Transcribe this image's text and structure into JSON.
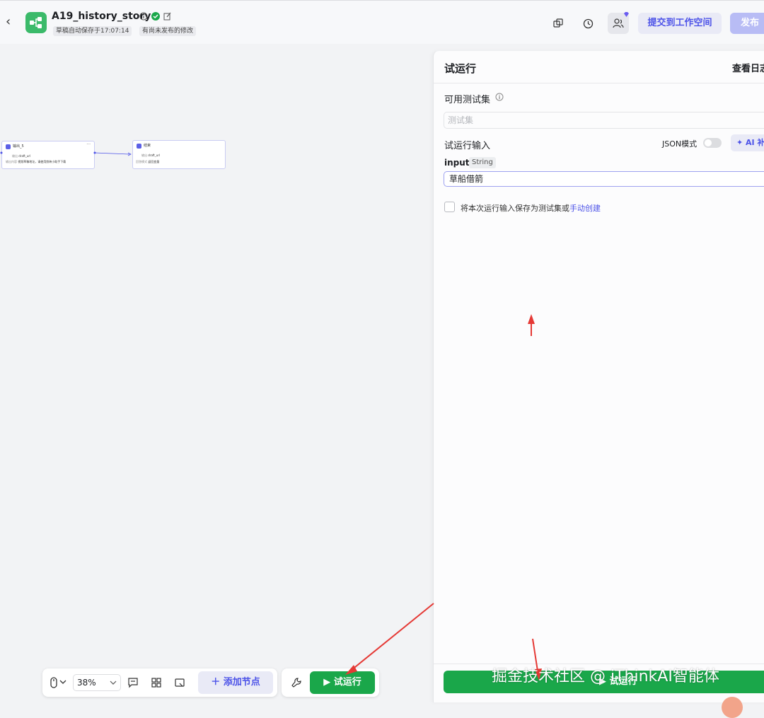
{
  "header": {
    "title": "A19_history_story",
    "autosave_tag": "草稿自动保存于17:07:14",
    "unpublished_tag": "有尚未发布的修改",
    "submit_label": "提交到工作空间",
    "publish_label": "发布"
  },
  "canvas": {
    "nodes": [
      {
        "title": "输出_5",
        "row1_key": "输出",
        "row1_val": "draft_url",
        "row2_key": "输出内容",
        "row2_val": "视频草稿地址，请使用剪映小助手下载"
      },
      {
        "title": "结束",
        "row1_key": "输出",
        "row1_val": "draft_url",
        "row2_key": "回答模式",
        "row2_val": "返回变量"
      }
    ],
    "zoom": "38%",
    "add_node_label": "添加节点",
    "run_label": "试运行"
  },
  "panel": {
    "title": "试运行",
    "view_log": "查看日志",
    "testset_label": "可用测试集",
    "testset_placeholder": "测试集",
    "run_input_label": "试运行输入",
    "json_mode_label": "JSON模式",
    "ai_button_label": "AI 补全",
    "input_name": "input",
    "input_type": "String",
    "input_value": "草船借箭",
    "save_checkbox_label": "将本次运行输入保存为测试集或",
    "manual_create_link": "手动创建",
    "run_button_label": "试运行"
  },
  "watermark": "掘金技术社区 @ iThinkAI智能体",
  "colors": {
    "accent": "#4d53e8",
    "run_green": "#1aa74a",
    "logo_green": "#3bba6a",
    "annotation_red": "#e53935"
  }
}
